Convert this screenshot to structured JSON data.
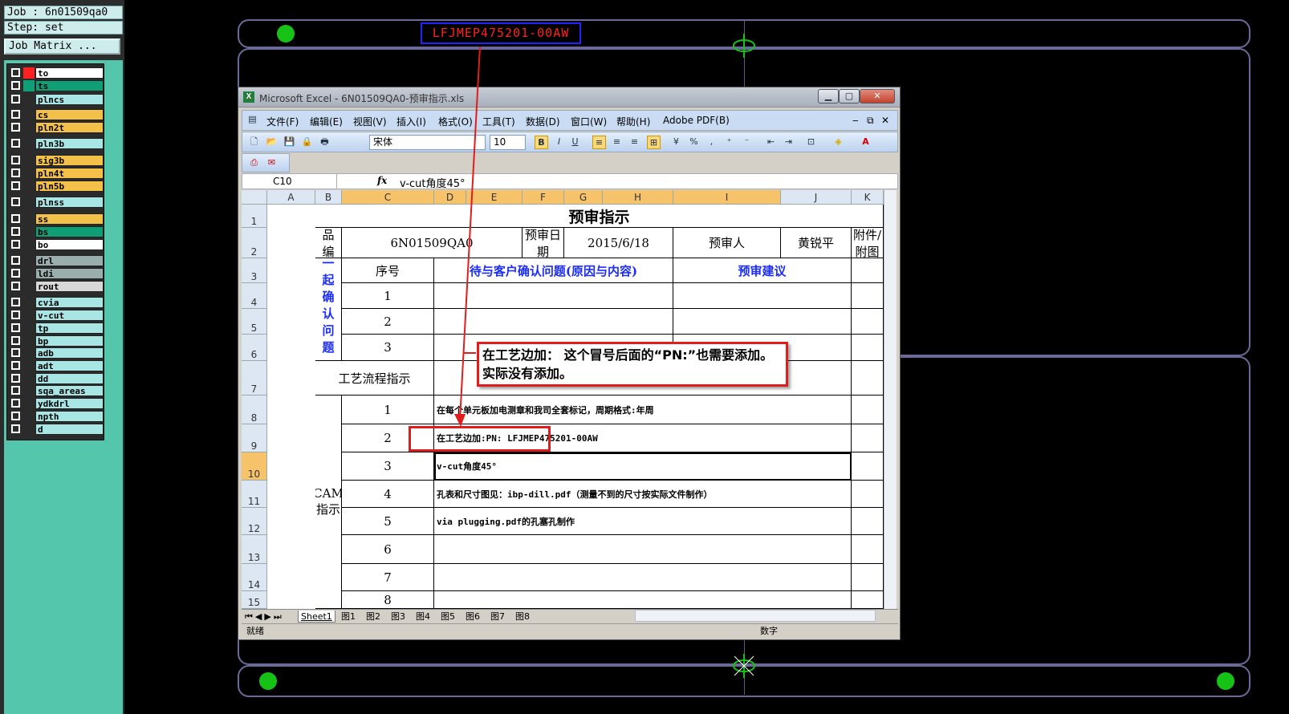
{
  "left_panel": {
    "job_line": "Job : 6n01509qa0",
    "step_line": "Step: set",
    "job_matrix_button": "Job Matrix ...",
    "layers": [
      {
        "name": "to",
        "color": "#ffffff",
        "top": true
      },
      {
        "name": "ts",
        "color": "#0f9e76"
      },
      {
        "name": "plncs",
        "color": "#a8e6e6"
      },
      {
        "name": "cs",
        "color": "#f3c04a"
      },
      {
        "name": "pln2t",
        "color": "#f3c04a"
      },
      {
        "name": "pln3b",
        "color": "#a8e6e6"
      },
      {
        "name": "sig3b",
        "color": "#f3c04a"
      },
      {
        "name": "pln4t",
        "color": "#f3c04a"
      },
      {
        "name": "pln5b",
        "color": "#f3c04a"
      },
      {
        "name": "plnss",
        "color": "#a8e6e6"
      },
      {
        "name": "ss",
        "color": "#f3c04a"
      },
      {
        "name": "bs",
        "color": "#0f9e76"
      },
      {
        "name": "bo",
        "color": "#ffffff"
      },
      {
        "name": "drl",
        "color": "#9aaeae"
      },
      {
        "name": "ldi",
        "color": "#9aaeae"
      },
      {
        "name": "rout",
        "color": "#d8d8d8"
      },
      {
        "name": "cvia",
        "color": "#a8e6e6"
      },
      {
        "name": "v-cut",
        "color": "#a8e6e6"
      },
      {
        "name": "tp",
        "color": "#a8e6e6"
      },
      {
        "name": "bp",
        "color": "#a8e6e6"
      },
      {
        "name": "adb",
        "color": "#a8e6e6"
      },
      {
        "name": "adt",
        "color": "#a8e6e6"
      },
      {
        "name": "dd",
        "color": "#a8e6e6"
      },
      {
        "name": "sqa_areas",
        "color": "#a8e6e6"
      },
      {
        "name": "ydkdrl",
        "color": "#a8e6e6"
      },
      {
        "name": "npth",
        "color": "#a8e6e6"
      },
      {
        "name": "d",
        "color": "#a8e6e6"
      }
    ]
  },
  "board": {
    "part_label": "LFJMEP475201-00AW"
  },
  "excel": {
    "title": "Microsoft Excel - 6N01509QA0-预审指示.xls",
    "menu": [
      "文件(F)",
      "编辑(E)",
      "视图(V)",
      "插入(I)",
      "格式(O)",
      "工具(T)",
      "数据(D)",
      "窗口(W)",
      "帮助(H)",
      "Adobe PDF(B)"
    ],
    "font_name": "宋体",
    "font_size": "10",
    "name_box": "C10",
    "formula": "v-cut角度45°",
    "columns": [
      "A",
      "B",
      "C",
      "D",
      "E",
      "F",
      "G",
      "H",
      "I",
      "J",
      "K"
    ],
    "rows": [
      "1",
      "2",
      "3",
      "4",
      "5",
      "6",
      "7",
      "8",
      "9",
      "10",
      "11",
      "12",
      "13",
      "14",
      "15"
    ],
    "sheet": {
      "title": "预审指示",
      "product_label": "产品编号",
      "product_no": "6N01509QA0",
      "review_date_label": "预审日期",
      "review_date": "2015/6/18",
      "reviewer_label": "预审人",
      "reviewer": "黄锐平",
      "attachment_label": "附件/附图",
      "seq_label": "序号",
      "customer_issue_header": "待与客户确认问题(原因与内容)",
      "suggestion_header": "预审建议",
      "pending_label": "待确认光绘时一起确认问题",
      "process_label": "工艺流程指示",
      "cam_label": "CAM指示",
      "issue_nums": [
        "1",
        "2",
        "3"
      ],
      "cam_nums": [
        "1",
        "2",
        "3",
        "4",
        "5",
        "6",
        "7",
        "8"
      ],
      "cam_items": [
        "在每个单元板加电测章和我司全套标记，周期格式:年周",
        "在工艺边加:PN: LFJMEP475201-00AW",
        "v-cut角度45°",
        "孔表和尺寸图见：ibp-dill.pdf（测量不到的尺寸按实际文件制作）",
        "via plugging.pdf的孔塞孔制作",
        "",
        "",
        ""
      ]
    },
    "sheet_tabs": [
      "Sheet1",
      "图1",
      "图2",
      "图3",
      "图4",
      "图5",
      "图6",
      "图7",
      "图8"
    ],
    "status_left": "就绪",
    "status_numlock": "数字"
  },
  "callout": {
    "text": "在工艺边加：  这个冒号后面的“PN:”也需要添加。实际没有添加。"
  },
  "colors": {
    "panel_bg": "#54c6ab",
    "outline": "#6a6a9a",
    "fiducial": "#17c217",
    "annotation_red": "#e01d1d",
    "label_blue_box": "#2222ff",
    "selected_header": "#f6c26a"
  }
}
